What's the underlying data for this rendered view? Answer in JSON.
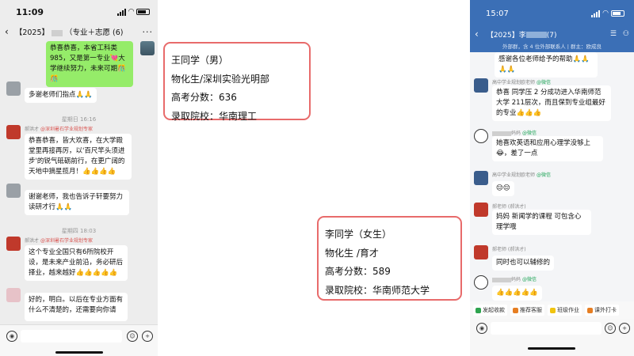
{
  "left_phone": {
    "time": "11:09",
    "title": "【2025】",
    "title_suffix": "（专业＋志愿 (6)",
    "messages": [
      {
        "text": "恭喜恭喜，本省工科类985，又是第一专业💘大学继续努力，未来可期🎊🎊"
      },
      {
        "text": "多谢老师们指点🙏🙏"
      },
      {
        "time": "星期日 16:16"
      },
      {
        "nick": "郝洪才",
        "org": "@深圳暑石学业规划专家",
        "text": "恭喜恭喜，皆大欢喜，在大学殿堂里再接再厉，以'百尺竿头须进步'的锐气砥砺前行，在更广阔的天地中摘星揽月！👍👍👍👍"
      },
      {
        "text": "谢谢老师，我也告诉子轩要努力读研才行🙏🙏"
      },
      {
        "time": "星期四 18:03"
      },
      {
        "nick": "郝洪才",
        "org": "@深圳暑石学业规划专家",
        "text": "这个专业全国只有6所院校开设，是未来产业前沿，务必研后择业，越来越好👍👍👍👍👍"
      },
      {
        "text": "好的，明白。以后在专业方面有什么不清楚的，还需要向你请"
      }
    ]
  },
  "student_1": {
    "name": "王同学（男）",
    "school": "物化生/深圳实验光明部",
    "score": "高考分数：636",
    "admitted_label": "录取院校：",
    "admitted_school": "华南理工"
  },
  "student_2": {
    "name": "李同学（女生）",
    "school": "物化生 /育才",
    "score": "高考分数：589",
    "admitted_label": "录取院校：",
    "admitted_school": "华南师范大学"
  },
  "right_phone": {
    "time": "15:07",
    "title": "【2025】李",
    "title_suffix": "(7)",
    "subtitle": "外部群，含 4 位外部联系人 | 群主：欧成良",
    "messages": [
      {
        "text": "感谢各位老师给予的帮助🙏🙏🙏🙏"
      },
      {
        "nick": "高中学业规划欧老师",
        "wx": "@微信",
        "text": "恭喜 同学压 2 分成功进入华南师范大学 211层次，而且保到专业组最好的专业👍👍👍"
      },
      {
        "nick": "妈妈",
        "wx": "@微信",
        "text": "她喜欢英语和应用心理学没够上😂，差了一点"
      },
      {
        "nick": "高中学业规划欧老师",
        "wx": "@微信",
        "text": "😔😔"
      },
      {
        "nick": "郝老师 (郝洪才)",
        "text": "妈妈 新闻学的课程 可包含心理学哦"
      },
      {
        "nick": "郝老师 (郝洪才)",
        "text": "同时也可以辅修的"
      },
      {
        "nick": "妈妈",
        "wx": "@微信",
        "text": "👍👍👍👍👍"
      }
    ],
    "quick_actions": [
      "发起收款",
      "推荐客服",
      "班级作业",
      "课外打卡"
    ]
  }
}
